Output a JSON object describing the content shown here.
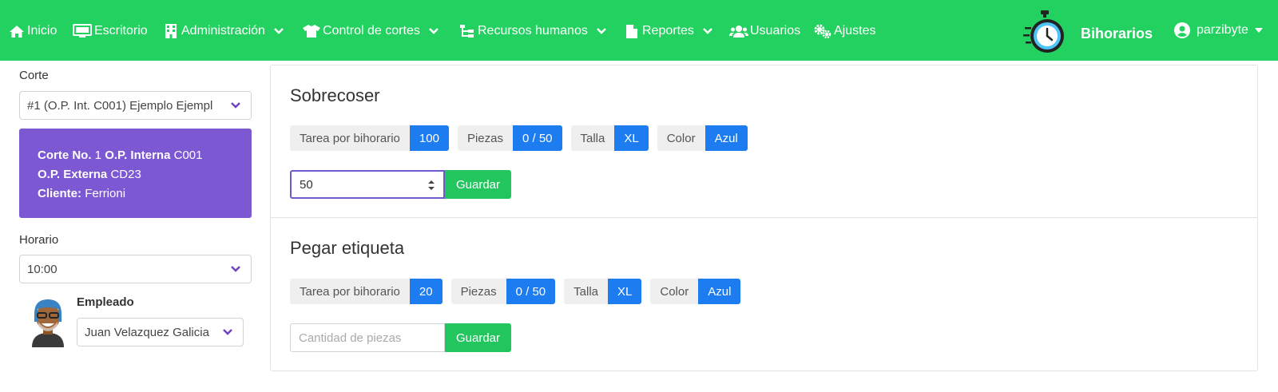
{
  "navbar": {
    "items": [
      {
        "label": "Inicio",
        "icon": "home-icon",
        "dropdown": false
      },
      {
        "label": "Escritorio",
        "icon": "desktop-icon",
        "dropdown": false
      },
      {
        "label": "Administración",
        "icon": "building-icon",
        "dropdown": true
      },
      {
        "label": "Control de cortes",
        "icon": "shirt-icon",
        "dropdown": true
      },
      {
        "label": "Recursos humanos",
        "icon": "sitemap-icon",
        "dropdown": true
      },
      {
        "label": "Reportes",
        "icon": "file-icon",
        "dropdown": true
      },
      {
        "label": "Usuarios",
        "icon": "users-icon",
        "dropdown": false
      },
      {
        "label": "Ajustes",
        "icon": "gears-icon",
        "dropdown": false
      }
    ],
    "brand": "Bihorarios",
    "user": "parzibyte",
    "bg_color": "#22d15f"
  },
  "sidebar": {
    "corte_label": "Corte",
    "corte_value": "#1 (O.P. Int. C001) Ejemplo Ejempl",
    "info": {
      "corte_no_label": "Corte No.",
      "corte_no": "1",
      "op_interna_label": "O.P. Interna",
      "op_interna": "C001",
      "op_externa_label": "O.P. Externa",
      "op_externa": "CD23",
      "cliente_label": "Cliente:",
      "cliente": "Ferrioni",
      "bg_color": "#7c58d3"
    },
    "horario_label": "Horario",
    "horario_value": "10:00",
    "empleado_label": "Empleado",
    "empleado_value": "Juan Velazquez Galicia"
  },
  "tasks": [
    {
      "title": "Sobrecoser",
      "tarea_label": "Tarea por bihorario",
      "tarea_value": "100",
      "piezas_label": "Piezas",
      "piezas_value": "0 / 50",
      "talla_label": "Talla",
      "talla_value": "XL",
      "color_label": "Color",
      "color_value": "Azul",
      "input_value": "50",
      "input_placeholder": "Cantidad de piezas",
      "save_label": "Guardar"
    },
    {
      "title": "Pegar etiqueta",
      "tarea_label": "Tarea por bihorario",
      "tarea_value": "20",
      "piezas_label": "Piezas",
      "piezas_value": "0 / 50",
      "talla_label": "Talla",
      "talla_value": "XL",
      "color_label": "Color",
      "color_value": "Azul",
      "input_value": "",
      "input_placeholder": "Cantidad de piezas",
      "save_label": "Guardar"
    }
  ]
}
